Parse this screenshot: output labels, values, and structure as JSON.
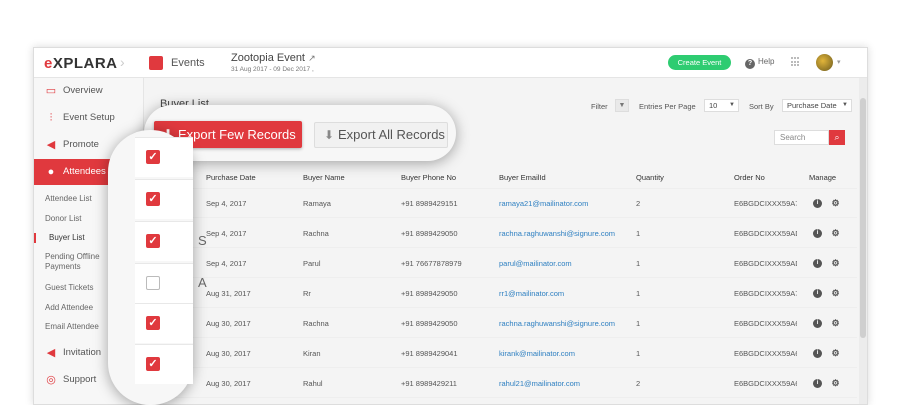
{
  "topbar": {
    "logo_accent": "e",
    "logo_rest": "XPLARA",
    "section_label": "Events",
    "event_title": "Zootopia Event",
    "event_dates": "31 Aug 2017 - 09 Dec 2017 ,",
    "create_event_label": "Create Event",
    "help_label": "Help"
  },
  "sidebar": {
    "items": [
      {
        "label": "Overview",
        "icon": "monitor-icon"
      },
      {
        "label": "Event Setup",
        "icon": "sliders-icon"
      },
      {
        "label": "Promote",
        "icon": "megaphone-icon"
      },
      {
        "label": "Attendees",
        "icon": "people-icon"
      }
    ],
    "sub_items": [
      "Attendee List",
      "Donor List",
      "Buyer List",
      "Pending Offline Payments",
      "Guest Tickets",
      "Add Attendee",
      "Email Attendee"
    ],
    "bottom_items": [
      {
        "label": "Invitation",
        "icon": "megaphone-icon"
      },
      {
        "label": "Support",
        "icon": "lifebuoy-icon"
      }
    ]
  },
  "main": {
    "title": "Buyer List",
    "filter_label": "Filter",
    "entries_label": "Entries Per Page",
    "entries_value": "10",
    "sort_label": "Sort By",
    "sort_value": "Purchase Date",
    "search_placeholder": "Search",
    "export_few_label": "Export Few Records",
    "export_all_label": "Export All Records"
  },
  "table": {
    "headers": [
      "Purchase Date",
      "Buyer Name",
      "Buyer Phone No",
      "Buyer EmailId",
      "Quantity",
      "Order No",
      "Manage"
    ],
    "rows": [
      {
        "date": "Sep 4, 2017",
        "name": "Ramaya",
        "phone": "+91 8989429151",
        "email": "ramaya21@mailinator.com",
        "qty": "2",
        "order": "E6BGDCIXXX59A7",
        "checked": true
      },
      {
        "date": "Sep 4, 2017",
        "name": "Rachna",
        "phone": "+91 8989429050",
        "email": "rachna.raghuwanshi@signure.com",
        "qty": "1",
        "order": "E6BGDCIXXX59AD",
        "checked": true
      },
      {
        "date": "Sep 4, 2017",
        "name": "Parul",
        "phone": "+91 76677878979",
        "email": "parul@mailinator.com",
        "qty": "1",
        "order": "E6BGDCIXXX59AD",
        "checked": true
      },
      {
        "date": "Aug 31, 2017",
        "name": "Rr",
        "phone": "+91 8989429050",
        "email": "rr1@mailinator.com",
        "qty": "1",
        "order": "E6BGDCIXXX59A7",
        "checked": false
      },
      {
        "date": "Aug 30, 2017",
        "name": "Rachna",
        "phone": "+91 8989429050",
        "email": "rachna.raghuwanshi@signure.com",
        "qty": "1",
        "order": "E6BGDCIXXX59A6",
        "checked": true
      },
      {
        "date": "Aug 30, 2017",
        "name": "Kiran",
        "phone": "+91 8989429041",
        "email": "kirank@mailinator.com",
        "qty": "1",
        "order": "E6BGDCIXXX59A6",
        "checked": true
      },
      {
        "date": "Aug 30, 2017",
        "name": "Rahul",
        "phone": "+91 8989429211",
        "email": "rahul21@mailinator.com",
        "qty": "2",
        "order": "E6BGDCIXXX59A6",
        "checked": false
      }
    ],
    "peek_letters": [
      "S",
      "A"
    ]
  },
  "colors": {
    "accent": "#e0393e",
    "create": "#2ecc71",
    "link": "#2d7fc1"
  }
}
